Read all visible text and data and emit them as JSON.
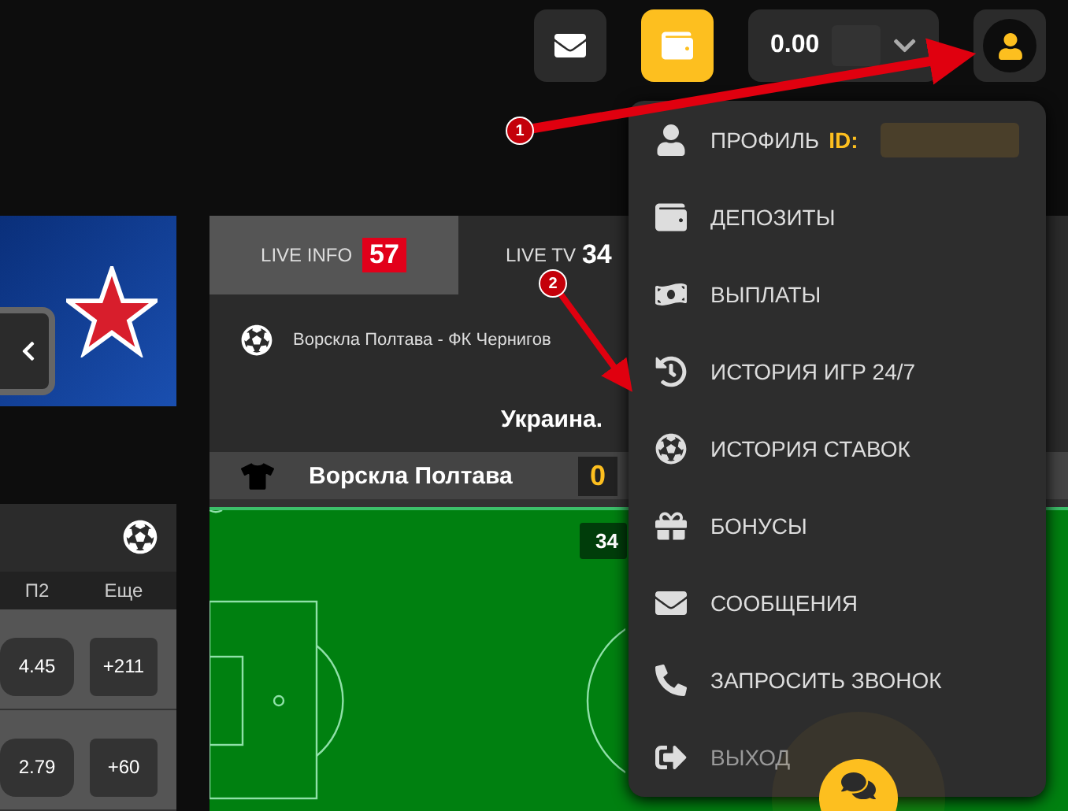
{
  "header": {
    "balance": "0.00"
  },
  "bets_panel": {
    "columns": [
      "П2",
      "Еще"
    ],
    "rows": [
      {
        "odds": "4.45",
        "more": "+211"
      },
      {
        "odds": "2.79",
        "more": "+60"
      }
    ]
  },
  "live_tabs": [
    {
      "label": "LIVE INFO",
      "count": "57",
      "selected": true
    },
    {
      "label": "LIVE TV",
      "count": "34",
      "selected": false
    }
  ],
  "match": {
    "title": "Ворскла Полтава - ФК Чернигов",
    "league": "Украина.",
    "team": "Ворскла Полтава",
    "score": "0",
    "minute": "34"
  },
  "account_menu": {
    "items": [
      {
        "label": "ПРОФИЛЬ",
        "id_label": "ID:"
      },
      {
        "label": "ДЕПОЗИТЫ"
      },
      {
        "label": "ВЫПЛАТЫ"
      },
      {
        "label": "ИСТОРИЯ ИГР 24/7"
      },
      {
        "label": "ИСТОРИЯ СТАВОК"
      },
      {
        "label": "БОНУСЫ"
      },
      {
        "label": "СООБЩЕНИЯ"
      },
      {
        "label": "ЗАПРОСИТЬ ЗВОНОК"
      },
      {
        "label": "ВЫХОД"
      }
    ]
  },
  "annotations": [
    {
      "number": "1"
    },
    {
      "number": "2"
    }
  ]
}
